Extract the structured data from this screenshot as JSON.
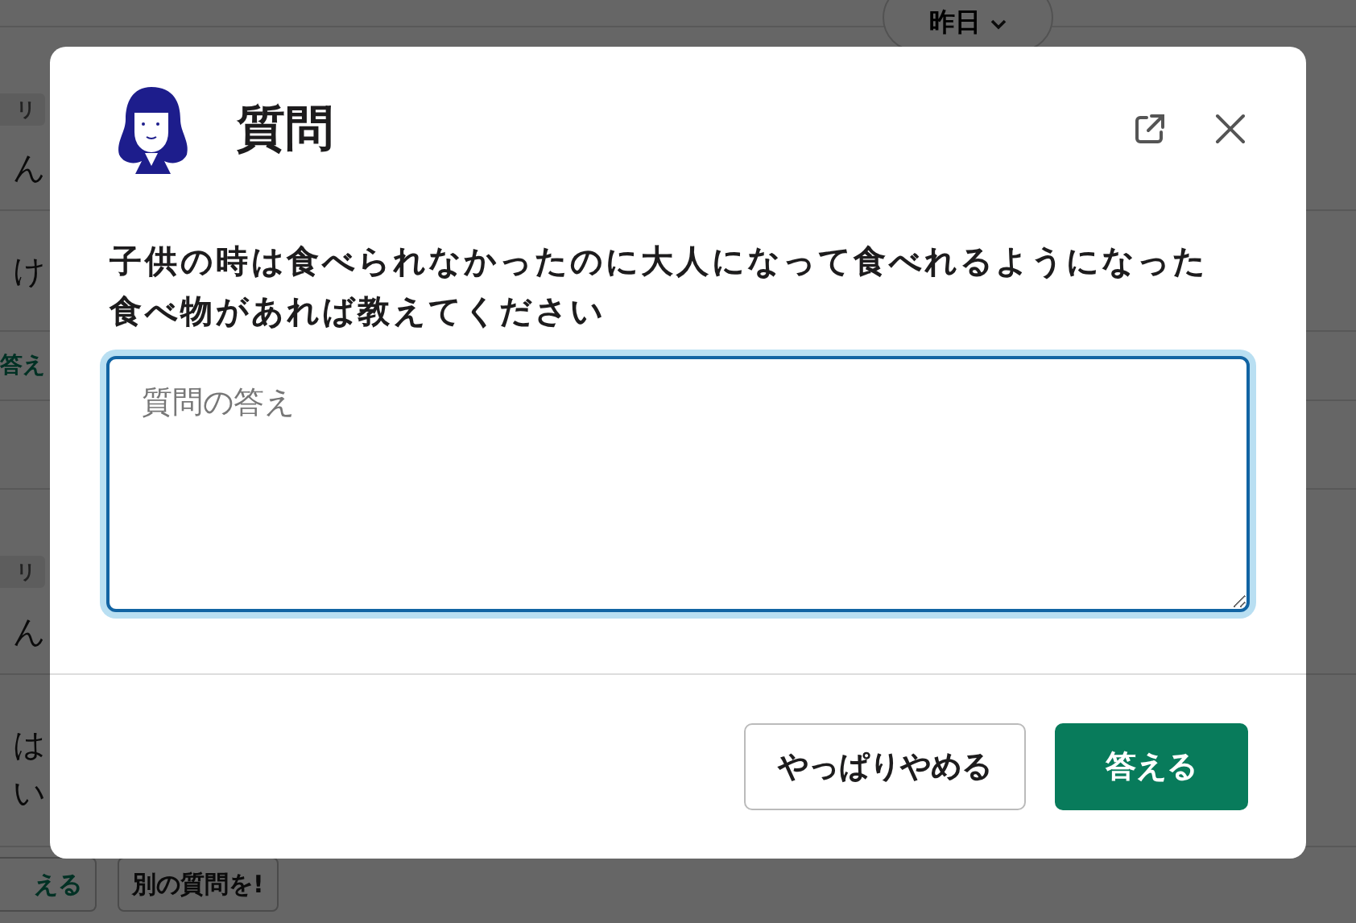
{
  "background": {
    "date_filter": {
      "label": "昨日"
    },
    "rows": [
      {
        "kind": "tag",
        "text": "リ"
      },
      {
        "kind": "text",
        "text": "ん"
      },
      {
        "kind": "divider"
      },
      {
        "kind": "text",
        "text": "け"
      },
      {
        "kind": "divider"
      },
      {
        "kind": "link",
        "text": "答え"
      },
      {
        "kind": "divider"
      },
      {
        "kind": "spacer"
      },
      {
        "kind": "divider"
      },
      {
        "kind": "tag",
        "text": "リ"
      },
      {
        "kind": "text",
        "text": "ん"
      },
      {
        "kind": "divider"
      },
      {
        "kind": "text",
        "text": "は"
      },
      {
        "kind": "text",
        "text": "い"
      },
      {
        "kind": "divider"
      },
      {
        "kind": "buttons",
        "buttons": [
          {
            "label": "える",
            "kind": "primary"
          },
          {
            "label": "別の質問を!",
            "kind": "secondary"
          }
        ]
      }
    ]
  },
  "dialog": {
    "title": "質問",
    "question": "子供の時は食べられなかったのに大人になって食べれるようになった食べ物があれば教えてください",
    "answer": {
      "placeholder": "質問の答え",
      "focused": true
    },
    "buttons": [
      {
        "label": "やっぱりやめる",
        "kind": "secondary"
      },
      {
        "label": "答える",
        "kind": "primary"
      }
    ]
  }
}
